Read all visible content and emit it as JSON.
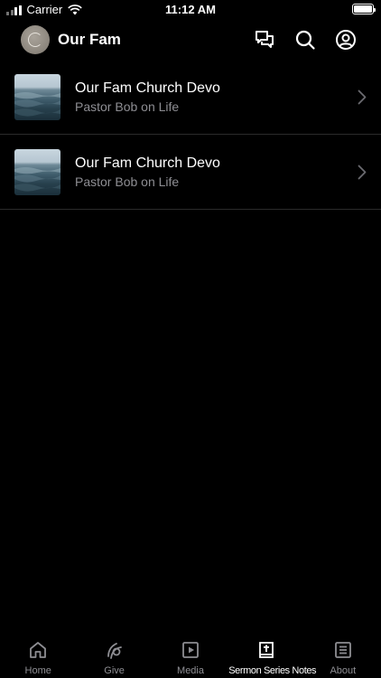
{
  "status_bar": {
    "carrier": "Carrier",
    "time": "11:12 AM"
  },
  "header": {
    "title": "Our Fam",
    "icons": [
      "messages-icon",
      "search-icon",
      "account-icon"
    ]
  },
  "list": {
    "items": [
      {
        "title": "Our Fam Church Devo",
        "subtitle": "Pastor Bob on Life"
      },
      {
        "title": "Our Fam Church Devo",
        "subtitle": "Pastor Bob on Life"
      }
    ]
  },
  "tabs": [
    {
      "label": "Home",
      "icon": "home-icon",
      "active": false
    },
    {
      "label": "Give",
      "icon": "give-icon",
      "active": false
    },
    {
      "label": "Media",
      "icon": "media-icon",
      "active": false
    },
    {
      "label": "Sermon Series Notes",
      "icon": "bible-icon",
      "active": true
    },
    {
      "label": "About",
      "icon": "about-icon",
      "active": false
    }
  ],
  "colors": {
    "background": "#000000",
    "text_primary": "#ffffff",
    "text_secondary": "#8e8e93",
    "separator": "#2a2a2a"
  }
}
